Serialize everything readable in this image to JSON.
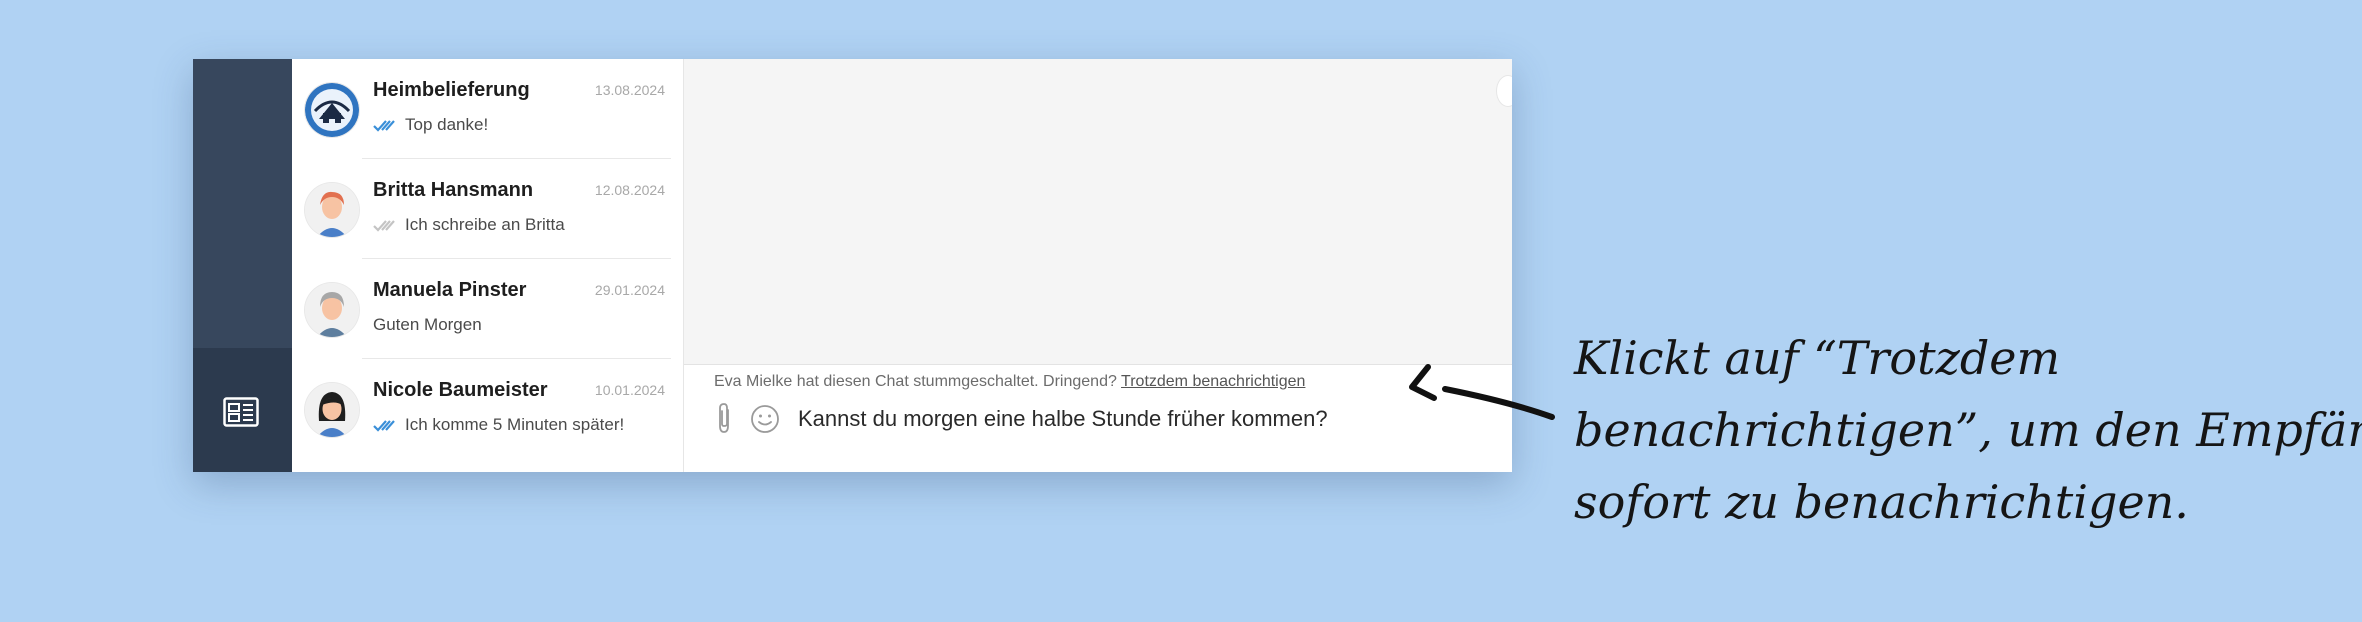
{
  "sidebar": {
    "bottom_icon": "news-icon"
  },
  "chats": [
    {
      "name": "Heimbelieferung",
      "date": "13.08.2024",
      "preview": "Top danke!",
      "ticks": "read",
      "avatar": "delivery-logo"
    },
    {
      "name": "Britta Hansmann",
      "date": "12.08.2024",
      "preview": "Ich schreibe an Britta",
      "ticks": "delivered",
      "avatar": "woman-red-hair"
    },
    {
      "name": "Manuela Pinster",
      "date": "29.01.2024",
      "preview": "Guten Morgen",
      "ticks": "none",
      "avatar": "woman-grey-hair"
    },
    {
      "name": "Nicole Baumeister",
      "date": "10.01.2024",
      "preview": "Ich komme 5 Minuten später!",
      "ticks": "read",
      "avatar": "woman-dark-hair"
    }
  ],
  "composer": {
    "mute_note": "Eva Mielke hat diesen Chat stummgeschaltet. Dringend?",
    "notify_link": "Trotzdem benachrichtigen",
    "message_value": "Kannst du morgen eine halbe Stunde früher kommen?"
  },
  "annotation": {
    "line1": "Klickt auf “Trotzdem",
    "line2": "benachrichtigen”, um den Empfänger",
    "line3": "sofort zu benachrichtigen."
  },
  "colors": {
    "background": "#b0d2f3",
    "sidebar": "#37475d",
    "sidebar_active": "#2c3a4e",
    "read_ticks": "#3a8fd8",
    "delivered_ticks": "#c4c4c4"
  }
}
